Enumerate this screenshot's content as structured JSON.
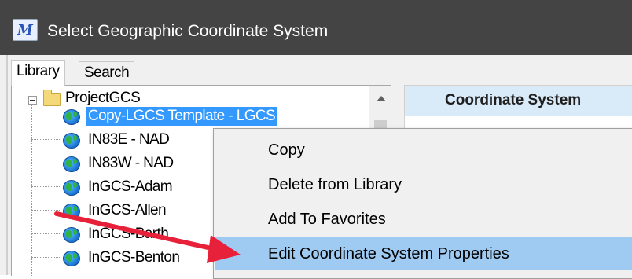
{
  "window": {
    "title": "Select Geographic Coordinate System",
    "app_icon": "microstation-logo-icon"
  },
  "tabs": [
    {
      "label": "Library",
      "active": true
    },
    {
      "label": "Search",
      "active": false
    }
  ],
  "tree": {
    "root": {
      "label": "ProjectGCS",
      "icon": "folder-icon",
      "expanded": true
    },
    "items": [
      {
        "label": "Copy-LGCS Template - LGCS",
        "icon": "globe-icon",
        "selected": true
      },
      {
        "label": "IN83E - NAD",
        "icon": "globe-icon",
        "selected": false
      },
      {
        "label": "IN83W - NAD",
        "icon": "globe-icon",
        "selected": false
      },
      {
        "label": "InGCS-Adam",
        "icon": "globe-icon",
        "selected": false
      },
      {
        "label": "InGCS-Allen",
        "icon": "globe-icon",
        "selected": false
      },
      {
        "label": "InGCS-Barth",
        "icon": "globe-icon",
        "selected": false
      },
      {
        "label": "InGCS-Benton",
        "icon": "globe-icon",
        "selected": false
      }
    ]
  },
  "details": {
    "header": "Coordinate System"
  },
  "context_menu": {
    "items": [
      {
        "label": "Copy",
        "highlighted": false
      },
      {
        "label": "Delete from Library",
        "highlighted": false
      },
      {
        "label": "Add To Favorites",
        "highlighted": false
      },
      {
        "label": "Edit Coordinate System Properties",
        "highlighted": true
      }
    ]
  },
  "colors": {
    "titlebar": "#444444",
    "selection": "#3399ff",
    "menu_highlight": "#9fcaf1",
    "arrow": "#e8213a"
  }
}
